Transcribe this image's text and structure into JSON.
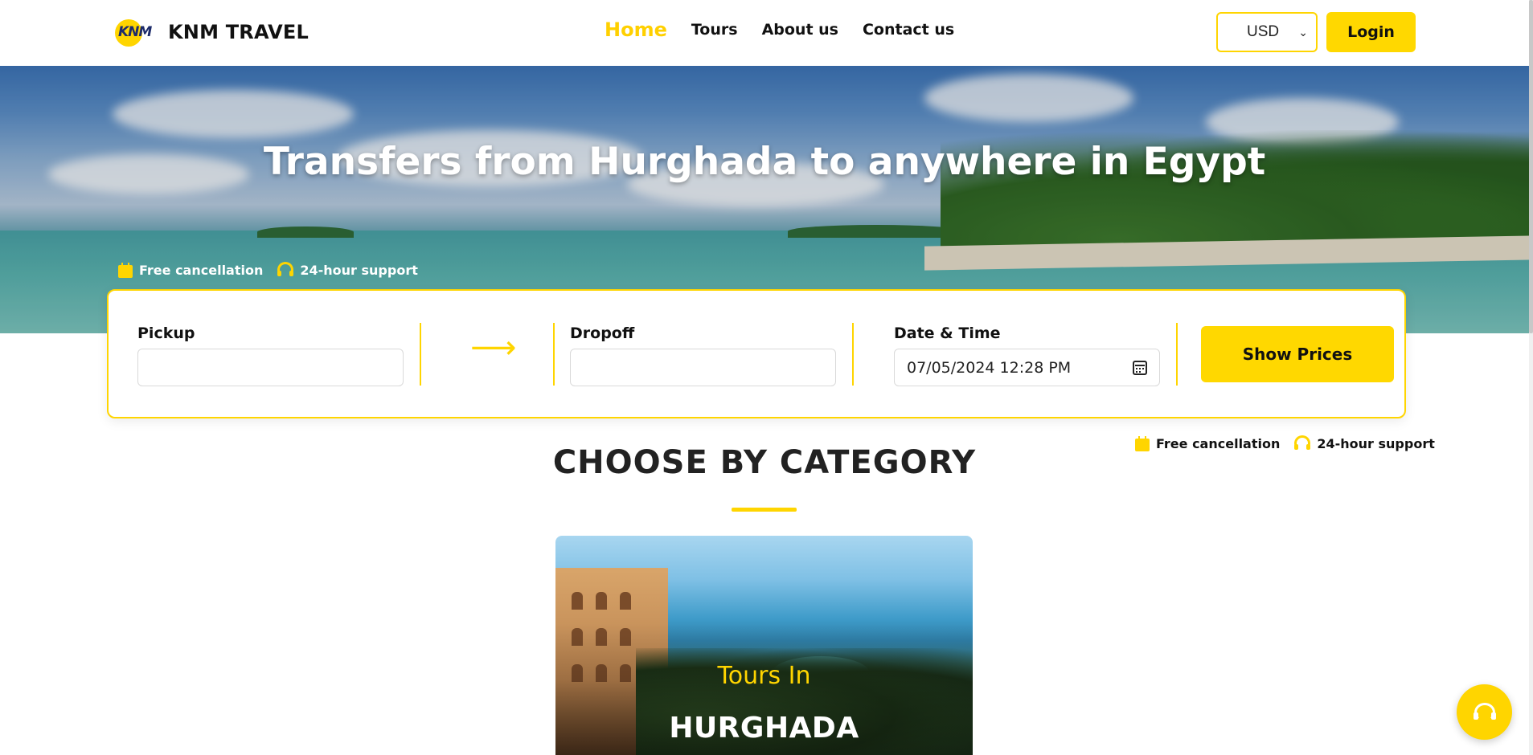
{
  "header": {
    "logo_mark": "KNM",
    "logo_text": "KNM TRAVEL",
    "nav": [
      "Home",
      "Tours",
      "About us",
      "Contact us"
    ],
    "active_nav": "Home",
    "currency": "USD",
    "login_label": "Login"
  },
  "hero": {
    "title": "Transfers from Hurghada to anywhere in Egypt",
    "perks": [
      "Free cancellation",
      "24-hour support"
    ]
  },
  "search": {
    "pickup_label": "Pickup",
    "pickup_value": "",
    "arrow": "⟶",
    "dropoff_label": "Dropoff",
    "dropoff_value": "",
    "datetime_label": "Date & Time",
    "datetime_value": "07/05/2024 12:28 PM",
    "submit_label": "Show Prices"
  },
  "perks_below": [
    "Free cancellation",
    "24-hour support"
  ],
  "category": {
    "title": "CHOOSE BY CATEGORY",
    "card": {
      "subtitle": "Tours In",
      "title": "HURGHADA"
    }
  },
  "colors": {
    "accent": "#ffd500",
    "text": "#111111"
  }
}
